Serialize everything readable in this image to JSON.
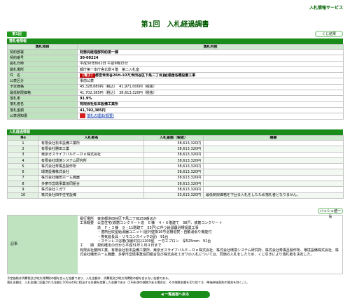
{
  "header": {
    "portal_link": "入札情報サービス",
    "page_title": "第1回　入札経過調書",
    "seq_badge": "第1回",
    "help_button": "くじ結果",
    "print_button": "ハッシュ値一覧",
    "back_button": "一覧画面へ戻る"
  },
  "summary": {
    "section_title": "落札者情報",
    "col_item": "落札項目",
    "col_content": "落札内容",
    "rows": [
      {
        "label": "契約部署",
        "value": "財務局経理部契約第一課",
        "bold": true
      },
      {
        "label": "契約番号",
        "value": "30-00224",
        "bold": true
      },
      {
        "label": "開札日時",
        "value": "平成30年8月2日 午前9時15分",
        "bold": false
      },
      {
        "label": "開札場所",
        "value": "都庁第一本庁舎北側４階　第二入札室",
        "bold": false
      },
      {
        "label": "件　名",
        "badge": "【電子】",
        "value": "都営世田谷26H-107[世田谷区下馬二丁目]給湯器浴槽設置工事",
        "bold": true
      },
      {
        "label": "公表区分",
        "value": "事前公表",
        "bold": false
      },
      {
        "label": "予定価格",
        "value": "45,328,680円（税込）　41,971,000円（税抜）",
        "bold": false
      },
      {
        "label": "最低制限価格",
        "value": "41,702,385円（税込）　38,613,320円（税抜）",
        "bold": false
      },
      {
        "label": "落札率",
        "value": "91.9%",
        "bold": true
      },
      {
        "label": "落札者名",
        "value": "有限会社松本設備工業所",
        "bold": true
      },
      {
        "label": "落札金額",
        "value": "41,702,385円",
        "bold": true
      },
      {
        "label": "公表通知書",
        "value": "落札の理由(概要)",
        "pdf": true
      }
    ]
  },
  "bids": {
    "section_title": "入札経過情報",
    "headers": [
      "No",
      "入札者名",
      "入札金額（税抜）",
      "摘要"
    ],
    "rows": [
      {
        "no": "1",
        "name": "有限会社松本設備工業所",
        "amount": "38,613,320円",
        "note": ""
      },
      {
        "no": "2",
        "name": "有限会社勝田工業",
        "amount": "38,613,320円",
        "note": ""
      },
      {
        "no": "3",
        "name": "東京ガスライフバルＥ－Ｄｏ株式会社",
        "amount": "38,613,320円",
        "note": ""
      },
      {
        "no": "4",
        "name": "有限会社環境システム研究所",
        "amount": "38,613,320円",
        "note": ""
      },
      {
        "no": "5",
        "name": "株式会社寿風呂製作所",
        "amount": "38,613,320円",
        "note": ""
      },
      {
        "no": "6",
        "name": "環境設備株式会社",
        "amount": "38,613,320円",
        "note": ""
      },
      {
        "no": "7",
        "name": "株式会社織田ホーム機器",
        "amount": "38,613,320円",
        "note": ""
      },
      {
        "no": "8",
        "name": "多摩市営繕事業協同組合",
        "amount": "38,613,320円",
        "note": ""
      },
      {
        "no": "9",
        "name": "株式会社エガワ",
        "amount": "38,613,320円",
        "note": ""
      },
      {
        "no": "10",
        "name": "株式会社田中住宅設備",
        "amount": "33,613,320円",
        "note": "最低制限価格を下回る入札をしたため落札者となりません。"
      }
    ]
  },
  "remarks": {
    "label": "記事",
    "text": "履行場所　東京都世田谷区下馬二丁目259番ほか\n工事概要　公営住宅(鉄筋コンクリート造　Ｅ棟　４・６階建て　38戸、鉄筋コンクリート\n　　　　　造　Ｆ・Ｉ棟　９・11階建て　53戸)に伴う給湯器浴槽設置工事\n　　　　　・潜熱回収型給湯器ユニット(屋外壁掛16号浴槽追焚・自動湯張り機能付\n　　　　　・排気延長具・リモコンスイッチ2個)　91台\n　　　　　・ステンレス浴槽(加齢対応)1200型　一方エプロン　深525mm　91台\n工　　期　契約確定の日から平成31年１月９日まで\n有限会社勝田工業、有限会社松本設備工業所、東京ガスライフバルＥ－Ｄｏ株式会社、株式会社環境システム研究所、株式会社寿風呂製作所、環境設備株式会社、株式会社織田ホーム機器、多摩市営繕事業協同組合及び株式会社エガワの入札については、同価の入札をしたため、くじ引きにより落札者を決定した。"
  },
  "footnote": "予定価格は消費税及び地方消費税の額を含んだ金額であり、入札金額は、消費税及び地方消費税の額を含まない金額である。\n落札金額は、入札金額に記載された金額に100分の8に相当する金額を加算した金額である（1円未満の端数がある場合は、その端数金額を切り捨てる（単価単価契約の場合を除く。））。"
}
